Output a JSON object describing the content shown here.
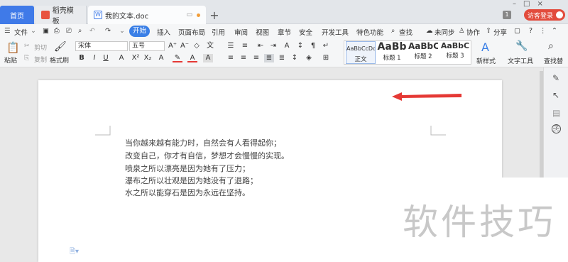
{
  "tabs": {
    "home": "首页",
    "templates": "稻壳模板",
    "document": "我的文本.doc"
  },
  "window": {
    "badge": "1",
    "login": "访客登录"
  },
  "menu": {
    "file": "文件",
    "items": [
      "开始",
      "插入",
      "页面布局",
      "引用",
      "审阅",
      "视图",
      "章节",
      "安全",
      "开发工具",
      "特色功能"
    ],
    "search": "查找",
    "sync": "未同步",
    "collab": "协作",
    "share": "分享"
  },
  "ribbon": {
    "paste": "粘贴",
    "cut": "剪切",
    "copy": "复制",
    "format_painter": "格式刷",
    "font_name": "宋体",
    "font_size": "五号",
    "styles": [
      {
        "preview": "AaBbCcDd",
        "name": "正文"
      },
      {
        "preview": "AaBb",
        "name": "标题 1"
      },
      {
        "preview": "AaBbC",
        "name": "标题 2"
      },
      {
        "preview": "AaBbC",
        "name": "标题 3"
      }
    ],
    "new_style": "新样式",
    "text_tools": "文字工具",
    "find_replace": "查找替"
  },
  "document": {
    "lines": [
      "当你越来越有能力时，自然会有人看得起你；",
      "改变自己，你才有自信，梦想才会慢慢的实现。",
      "喷泉之所以漂亮是因为她有了压力；",
      "瀑布之所以壮观是因为她没有了退路；",
      "水之所以能穿石是因为永远在坚持。"
    ]
  },
  "watermark": "软件技巧",
  "colors": {
    "accent": "#3a7fe6",
    "login": "#e24b3c",
    "arrow": "#e53935"
  }
}
